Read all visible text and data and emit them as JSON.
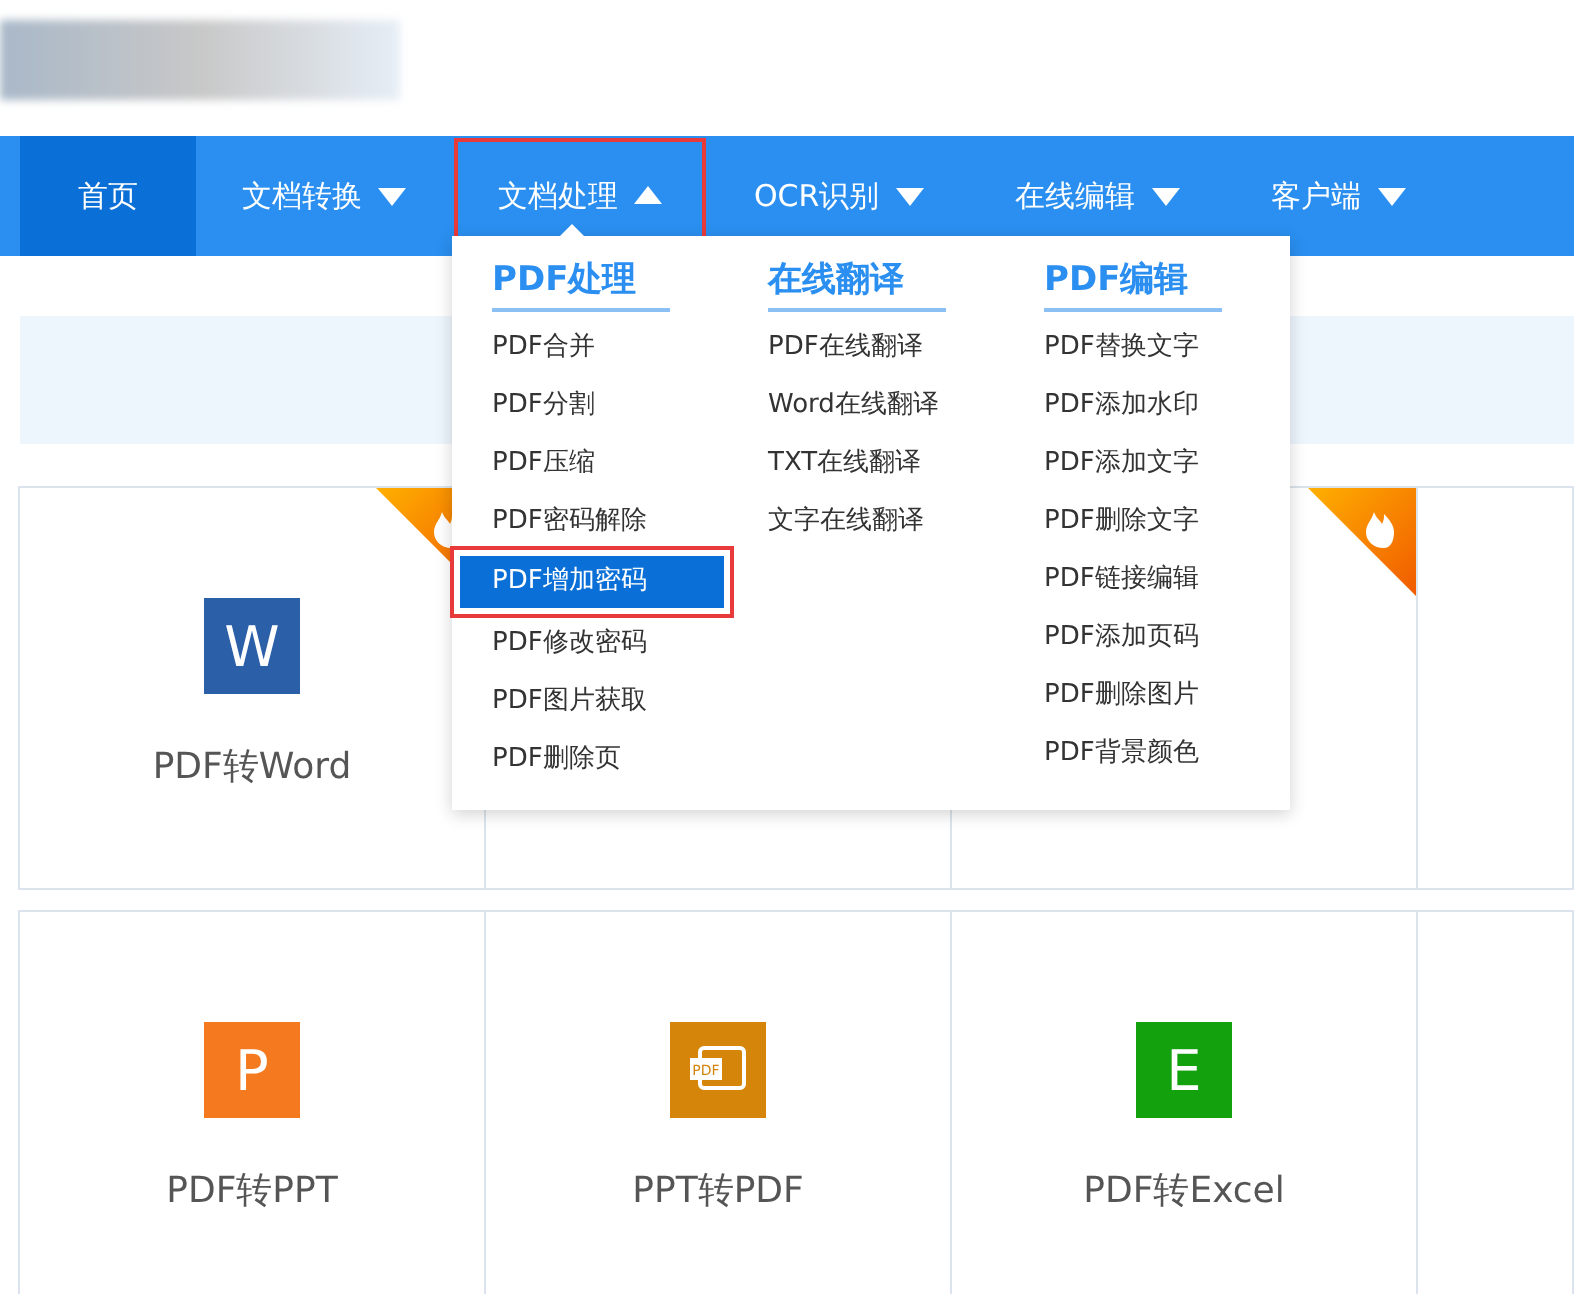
{
  "nav": [
    {
      "label": "首页",
      "selected": true,
      "has_menu": false,
      "expanded": false,
      "annotated": false
    },
    {
      "label": "文档转换",
      "selected": false,
      "has_menu": true,
      "expanded": false,
      "annotated": false
    },
    {
      "label": "文档处理",
      "selected": false,
      "has_menu": true,
      "expanded": true,
      "annotated": true
    },
    {
      "label": "OCR识别",
      "selected": false,
      "has_menu": true,
      "expanded": false,
      "annotated": false
    },
    {
      "label": "在线编辑",
      "selected": false,
      "has_menu": true,
      "expanded": false,
      "annotated": false
    },
    {
      "label": "客户端",
      "selected": false,
      "has_menu": true,
      "expanded": false,
      "annotated": false
    }
  ],
  "dropdown": {
    "columns": [
      {
        "heading": "PDF处理",
        "items": [
          {
            "label": "PDF合并",
            "selected": false,
            "annotated": false
          },
          {
            "label": "PDF分割",
            "selected": false,
            "annotated": false
          },
          {
            "label": "PDF压缩",
            "selected": false,
            "annotated": false
          },
          {
            "label": "PDF密码解除",
            "selected": false,
            "annotated": false
          },
          {
            "label": "PDF增加密码",
            "selected": true,
            "annotated": true
          },
          {
            "label": "PDF修改密码",
            "selected": false,
            "annotated": false
          },
          {
            "label": "PDF图片获取",
            "selected": false,
            "annotated": false
          },
          {
            "label": "PDF删除页",
            "selected": false,
            "annotated": false
          }
        ]
      },
      {
        "heading": "在线翻译",
        "items": [
          {
            "label": "PDF在线翻译",
            "selected": false,
            "annotated": false
          },
          {
            "label": "Word在线翻译",
            "selected": false,
            "annotated": false
          },
          {
            "label": "TXT在线翻译",
            "selected": false,
            "annotated": false
          },
          {
            "label": "文字在线翻译",
            "selected": false,
            "annotated": false
          }
        ]
      },
      {
        "heading": "PDF编辑",
        "items": [
          {
            "label": "PDF替换文字",
            "selected": false,
            "annotated": false
          },
          {
            "label": "PDF添加水印",
            "selected": false,
            "annotated": false
          },
          {
            "label": "PDF添加文字",
            "selected": false,
            "annotated": false
          },
          {
            "label": "PDF删除文字",
            "selected": false,
            "annotated": false
          },
          {
            "label": "PDF链接编辑",
            "selected": false,
            "annotated": false
          },
          {
            "label": "PDF添加页码",
            "selected": false,
            "annotated": false
          },
          {
            "label": "PDF删除图片",
            "selected": false,
            "annotated": false
          },
          {
            "label": "PDF背景颜色",
            "selected": false,
            "annotated": false
          }
        ]
      }
    ]
  },
  "tools": [
    {
      "kind": "letter",
      "icon_text": "W",
      "color": "#2b5fa8",
      "label": "PDF转Word",
      "hot": true
    },
    {
      "kind": "blank",
      "hot": false
    },
    {
      "kind": "blank",
      "hot": true
    },
    {
      "kind": "blank",
      "hot": false
    },
    {
      "kind": "letter",
      "icon_text": "P",
      "color": "#f57a1f",
      "label": "PDF转PPT",
      "hot": false
    },
    {
      "kind": "pdf",
      "icon_text": "PDF",
      "color": "#d4850a",
      "label": "PPT转PDF",
      "hot": false
    },
    {
      "kind": "letter",
      "icon_text": "E",
      "color": "#14a10e",
      "label": "PDF转Excel",
      "hot": false
    },
    {
      "kind": "blank",
      "hot": false
    }
  ]
}
